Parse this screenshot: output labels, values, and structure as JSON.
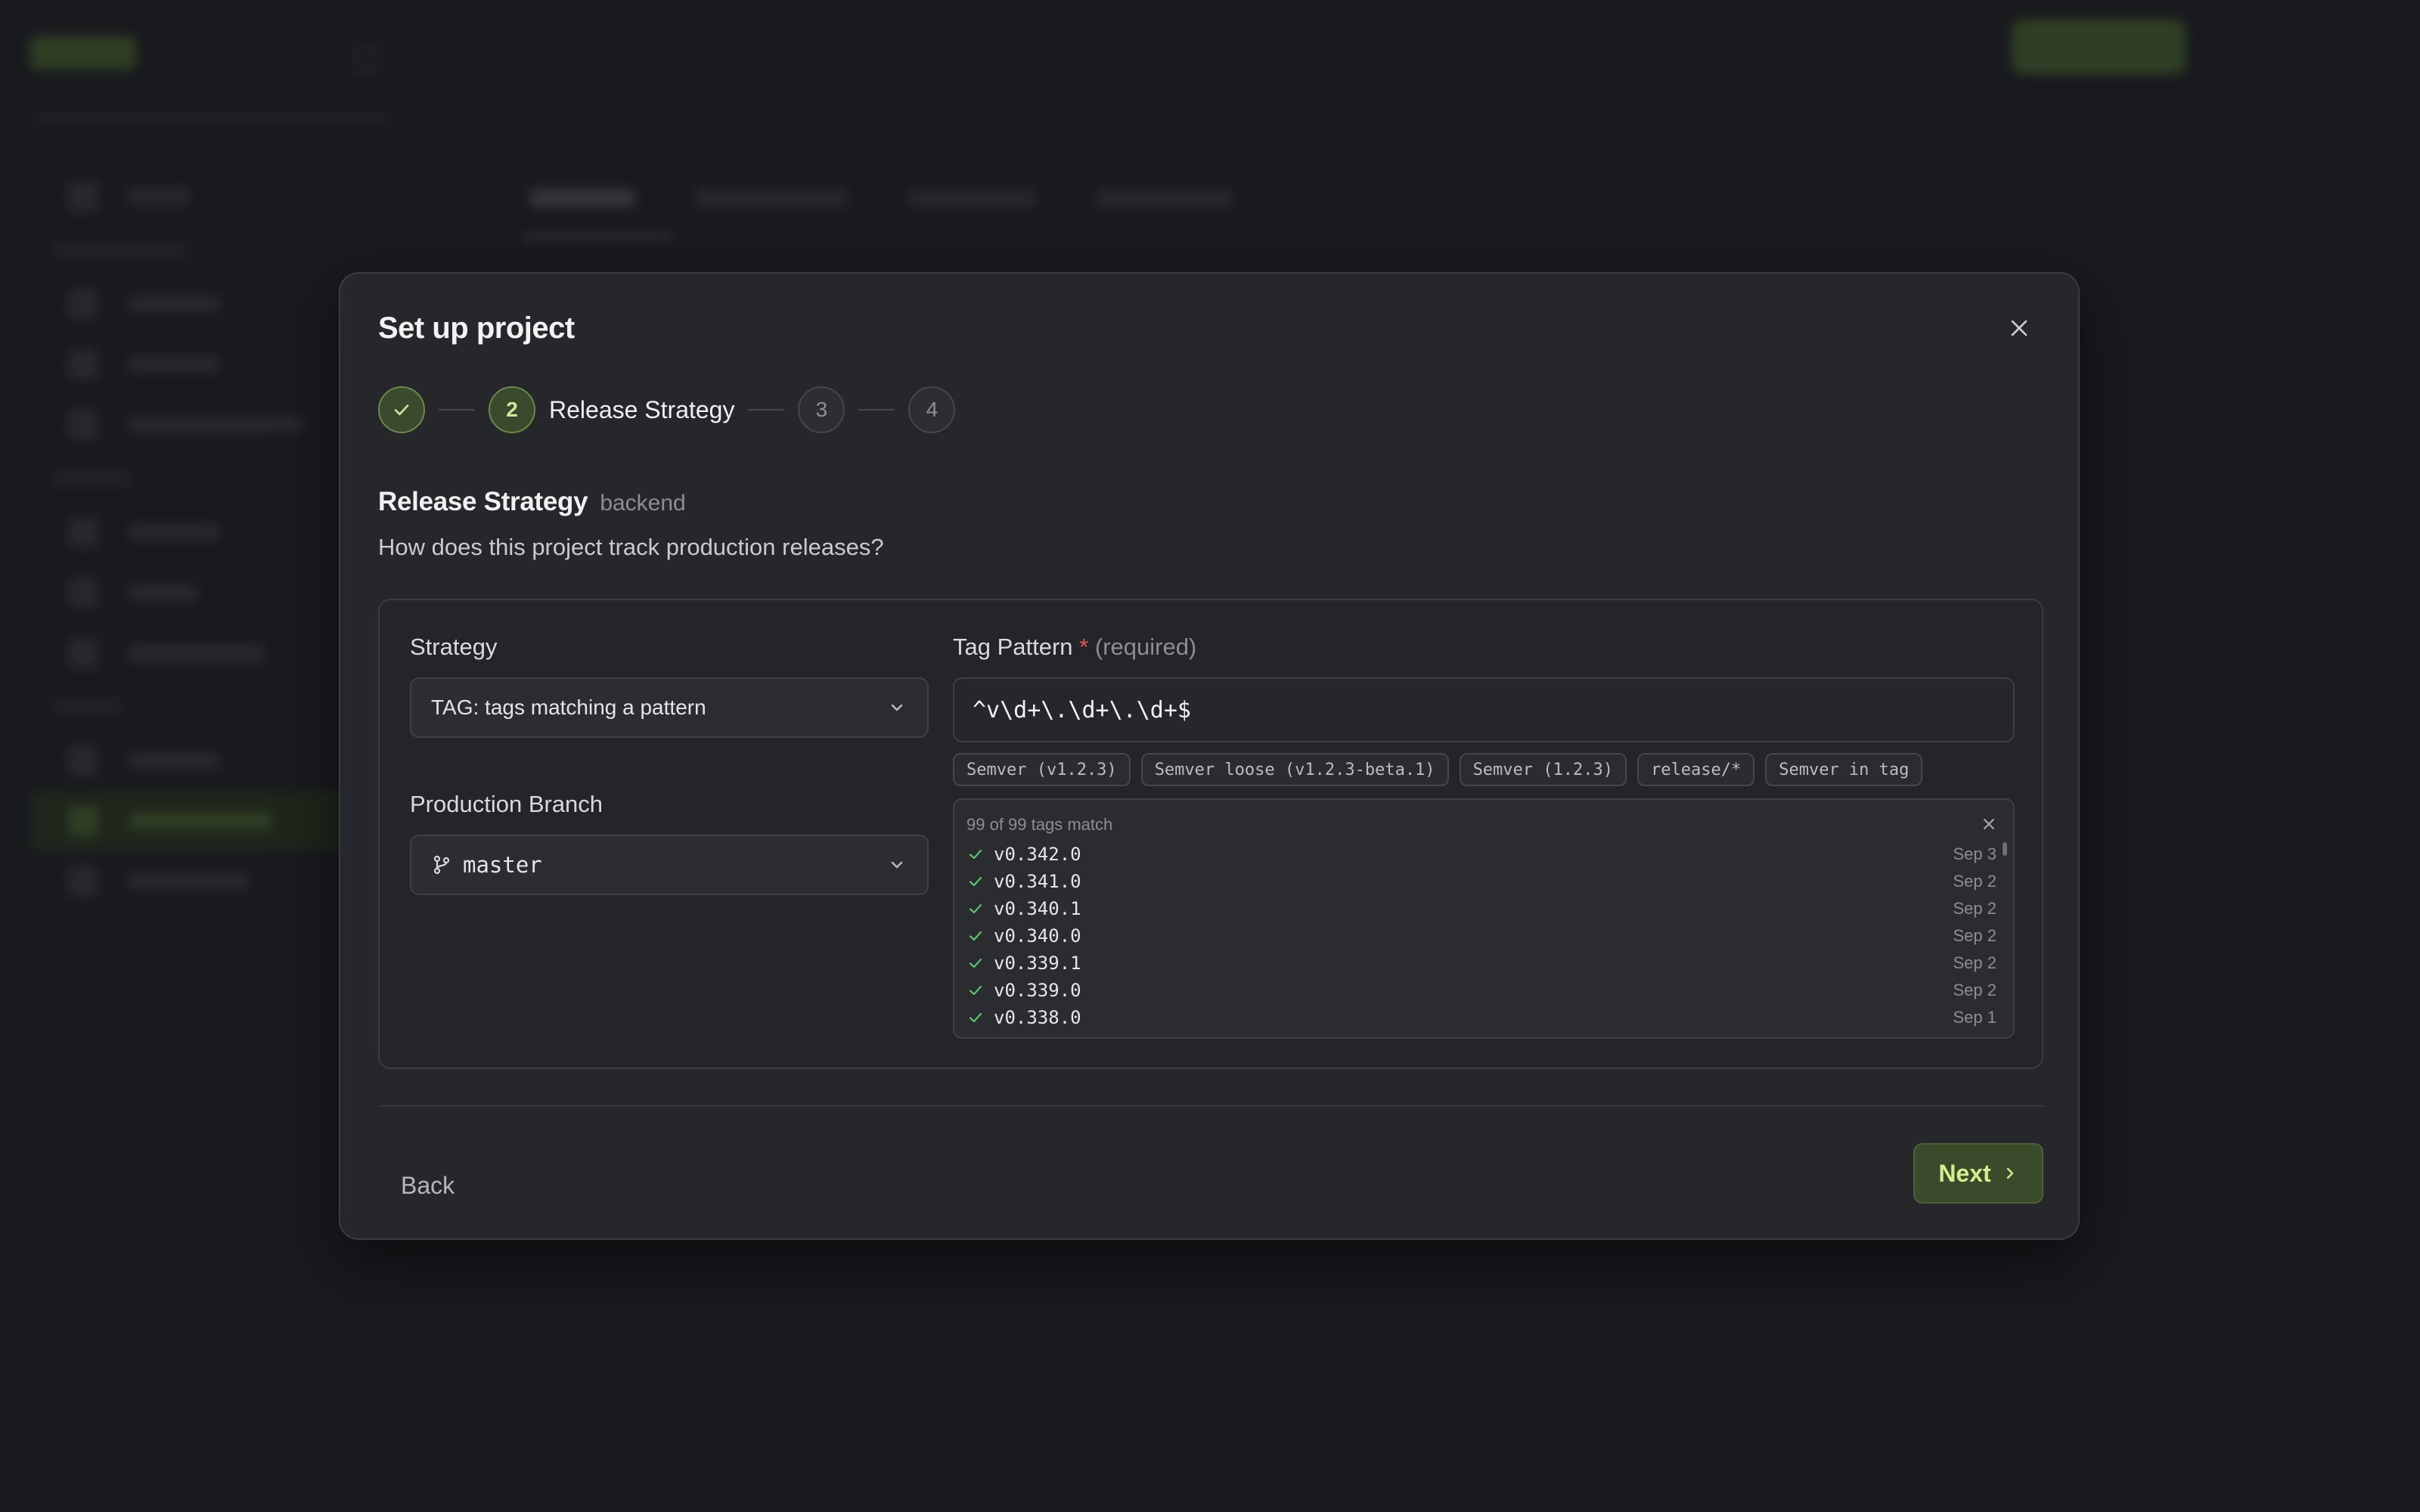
{
  "modal": {
    "title": "Set up project",
    "close_icon": "close-icon"
  },
  "stepper": {
    "current_step": 2,
    "steps": [
      {
        "number": "1",
        "state": "completed",
        "icon": "check-icon"
      },
      {
        "number": "2",
        "state": "current",
        "label": "Release Strategy"
      },
      {
        "number": "3",
        "state": "upcoming"
      },
      {
        "number": "4",
        "state": "upcoming"
      }
    ]
  },
  "section": {
    "title": "Release Strategy",
    "project": "backend",
    "description": "How does this project track production releases?"
  },
  "strategy": {
    "label": "Strategy",
    "selected": "TAG: tags matching a pattern"
  },
  "branch": {
    "label": "Production Branch",
    "selected": "master",
    "icon": "git-branch-icon"
  },
  "tag_pattern": {
    "label": "Tag Pattern",
    "required_mark": "*",
    "required_note": "(required)",
    "value": "^v\\d+\\.\\d+\\.\\d+$",
    "presets": [
      "Semver (v1.2.3)",
      "Semver loose (v1.2.3-beta.1)",
      "Semver (1.2.3)",
      "release/*",
      "Semver in tag"
    ]
  },
  "matches": {
    "summary": "99 of 99 tags match",
    "rows": [
      {
        "tag": "v0.342.0",
        "date": "Sep 3"
      },
      {
        "tag": "v0.341.0",
        "date": "Sep 2"
      },
      {
        "tag": "v0.340.1",
        "date": "Sep 2"
      },
      {
        "tag": "v0.340.0",
        "date": "Sep 2"
      },
      {
        "tag": "v0.339.1",
        "date": "Sep 2"
      },
      {
        "tag": "v0.339.0",
        "date": "Sep 2"
      },
      {
        "tag": "v0.338.0",
        "date": "Sep 1"
      }
    ]
  },
  "footer": {
    "back_label": "Back",
    "next_label": "Next"
  },
  "colors": {
    "background": "#202226",
    "modal": "#25272b",
    "accent": "#d2ef8f",
    "accent_bg": "#3a4a2a",
    "success": "#5cc36a",
    "required": "#e0554d"
  }
}
